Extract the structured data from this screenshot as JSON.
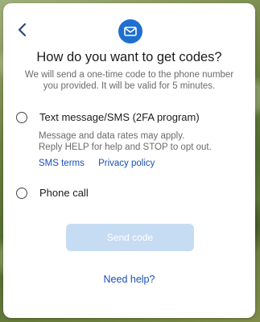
{
  "header": {
    "title": "How do you want to get codes?",
    "subtitle": "We will send a one-time code to the phone number you provided. It will be valid for 5 minutes."
  },
  "icons": {
    "back": "chevron-left-icon",
    "mail": "envelope-icon",
    "accent": "#1f6fd1"
  },
  "options": [
    {
      "label": "Text message/SMS (2FA program)",
      "note_lines": [
        "Message and data rates may apply.",
        "Reply HELP for help and STOP to opt out."
      ],
      "links": [
        "SMS terms",
        "Privacy policy"
      ],
      "selected": false
    },
    {
      "label": "Phone call",
      "selected": false
    }
  ],
  "actions": {
    "send_label": "Send code",
    "help_label": "Need help?"
  }
}
